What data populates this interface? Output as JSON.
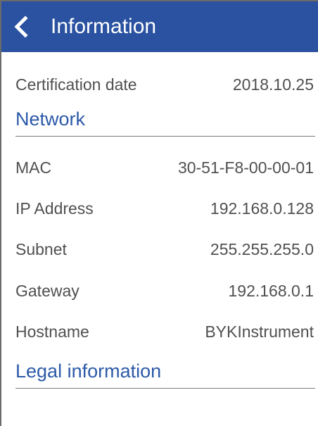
{
  "colors": {
    "header_bg": "#2a52a0",
    "header_text": "#ffffff",
    "section_text": "#2d5aa8",
    "row_text": "#505050",
    "divider": "#7a7a7a"
  },
  "header": {
    "back_icon": "chevron-left-icon",
    "title": "Information"
  },
  "certification": {
    "label": "Certification date",
    "value": "2018.10.25"
  },
  "network": {
    "heading": "Network",
    "rows": [
      {
        "label": "MAC",
        "value": "30-51-F8-00-00-01"
      },
      {
        "label": "IP Address",
        "value": "192.168.0.128"
      },
      {
        "label": "Subnet",
        "value": "255.255.255.0"
      },
      {
        "label": "Gateway",
        "value": "192.168.0.1"
      },
      {
        "label": "Hostname",
        "value": "BYKInstrument"
      }
    ]
  },
  "legal": {
    "heading": "Legal information"
  }
}
